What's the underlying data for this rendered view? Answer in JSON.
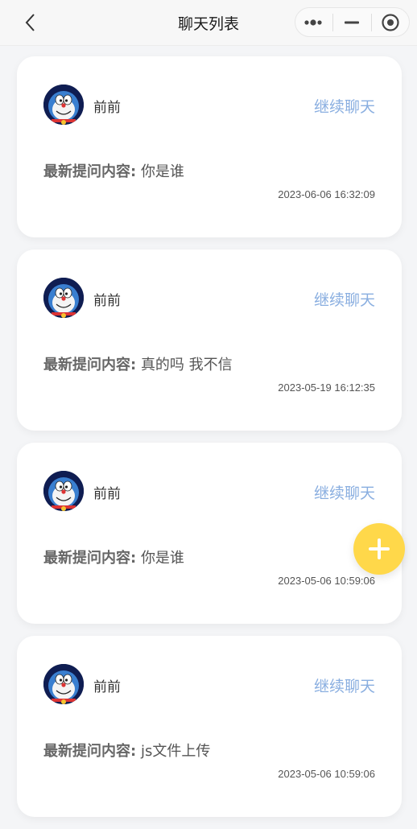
{
  "navbar": {
    "title": "聊天列表",
    "back_icon": "chevron-left-icon",
    "capsule": [
      "more-dots-icon",
      "minimize-icon",
      "close-target-icon"
    ]
  },
  "colors": {
    "accent_link": "#89aee0",
    "fab": "#ffd84a",
    "background": "#f4f5f7"
  },
  "chats": [
    {
      "name": "前前",
      "action": "继续聊天",
      "question_label": "最新提问内容:",
      "question": "你是谁",
      "time": "2023-06-06 16:32:09"
    },
    {
      "name": "前前",
      "action": "继续聊天",
      "question_label": "最新提问内容:",
      "question": "真的吗 我不信",
      "time": "2023-05-19 16:12:35"
    },
    {
      "name": "前前",
      "action": "继续聊天",
      "question_label": "最新提问内容:",
      "question": "你是谁",
      "time": "2023-05-06 10:59:06"
    },
    {
      "name": "前前",
      "action": "继续聊天",
      "question_label": "最新提问内容:",
      "question": "js文件上传",
      "time": "2023-05-06 10:59:06"
    }
  ],
  "fab": {
    "icon": "plus-icon"
  }
}
